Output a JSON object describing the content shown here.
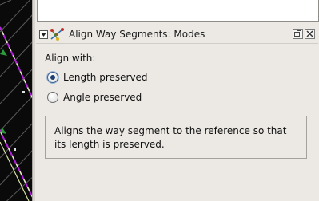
{
  "dialog": {
    "title": "Align Way Segments: Modes",
    "icon": "align-way-segments-icon",
    "title_buttons": [
      "dock-icon",
      "close-icon"
    ]
  },
  "align_with_label": "Align with:",
  "options": [
    {
      "label": "Length preserved",
      "selected": true
    },
    {
      "label": "Angle preserved",
      "selected": false
    }
  ],
  "description": "Aligns the way segment to the reference so that its length is preserved.",
  "colors": {
    "background": "#ece9e5",
    "map_background": "#0a0a0a",
    "way_highlight": "#b21fd8",
    "way_line": "#e8e8c8"
  }
}
